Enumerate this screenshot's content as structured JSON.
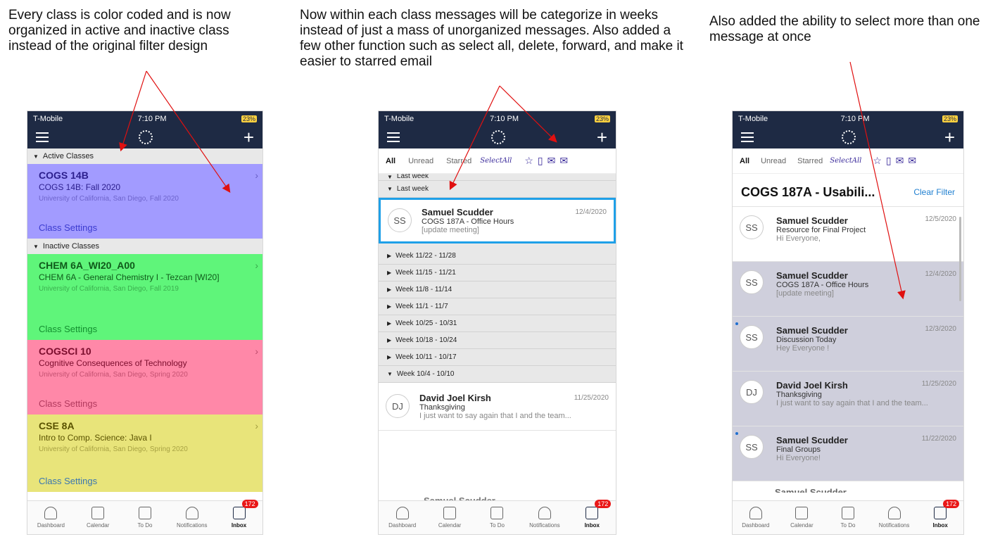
{
  "captions": {
    "left": "Every class is color coded and is now organized in active and inactive class instead of the original filter design",
    "middle": "Now within each class messages will be categorize in weeks instead of just a mass of unorganized messages. Also added a few other function such as select all, delete, forward, and make it easier to starred email",
    "right": "Also added the ability to select more than one message at once"
  },
  "status_bar": {
    "carrier": "T-Mobile",
    "time": "7:10 PM",
    "battery": "23%"
  },
  "tab_bar": {
    "items": [
      {
        "label": "Dashboard",
        "icon": "dashboard-icon"
      },
      {
        "label": "Calendar",
        "icon": "calendar-icon"
      },
      {
        "label": "To Do",
        "icon": "todo-icon"
      },
      {
        "label": "Notifications",
        "icon": "bell-icon"
      },
      {
        "label": "Inbox",
        "icon": "mail-icon"
      }
    ],
    "inbox_badge": "172"
  },
  "phone1": {
    "active_header": "Active Classes",
    "inactive_header": "Inactive Classes",
    "courses": [
      {
        "code": "COGS 14B",
        "title": "COGS 14B: Fall 2020",
        "school": "University of California, San Diego, Fall 2020",
        "settings": "Class Settings",
        "color": "#a29bff",
        "text_color": "#2b1e8c",
        "settings_color": "#3b3bd0"
      },
      {
        "code": "CHEM 6A_WI20_A00",
        "title": "CHEM 6A - General Chemistry I - Tezcan [WI20]",
        "school": "University of California, San Diego, Fall 2019",
        "settings": "Class Settings",
        "color": "#5ff57a",
        "text_color": "#0f5a1a",
        "settings_color": "#138f2f"
      },
      {
        "code": "COGSCI 10",
        "title": "Cognitive Consequences of Technology",
        "school": "University of California, San Diego, Spring 2020",
        "settings": "Class Settings",
        "color": "#ff88a8",
        "text_color": "#7a0c2c",
        "settings_color": "#b23a5e"
      },
      {
        "code": "CSE 8A",
        "title": "Intro to Comp. Science: Java I",
        "school": "University of California, San Diego, Spring 2020",
        "settings": "Class Settings",
        "color": "#e8e47a",
        "text_color": "#5a5200",
        "settings_color": "#3a76b0"
      }
    ]
  },
  "inbox": {
    "filters": [
      "All",
      "Unread",
      "Starred"
    ],
    "select_all": "SelectAll"
  },
  "phone2": {
    "clipped_week": "Last week",
    "last_week": "Last week",
    "selected_message": {
      "initials": "SS",
      "sender": "Samuel Scudder",
      "date": "12/4/2020",
      "subject": "COGS 187A - Office Hours",
      "preview": "[update meeting]"
    },
    "weeks": [
      "Week 11/22 - 11/28",
      "Week 11/15 - 11/21",
      "Week 11/8 - 11/14",
      "Week 11/1 - 11/7",
      "Week 10/25 - 10/31",
      "Week 10/18 - 10/24",
      "Week 10/11 - 10/17"
    ],
    "open_week": "Week 10/4 - 10/10",
    "open_message": {
      "initials": "DJ",
      "sender": "David Joel Kirsh",
      "date": "11/25/2020",
      "subject": "Thanksgiving",
      "preview": "I just want to say again that I and the team..."
    },
    "partial_sender": "Samuel Scudder"
  },
  "phone3": {
    "course_title": "COGS 187A - Usabili...",
    "clear_filter": "Clear Filter",
    "messages": [
      {
        "initials": "SS",
        "sender": "Samuel Scudder",
        "date": "12/5/2020",
        "subject": "Resource for Final Project",
        "preview": "Hi Everyone,",
        "selected": false,
        "unread": false
      },
      {
        "initials": "SS",
        "sender": "Samuel Scudder",
        "date": "12/4/2020",
        "subject": "COGS 187A - Office Hours",
        "preview": "[update meeting]",
        "selected": true,
        "unread": false
      },
      {
        "initials": "SS",
        "sender": "Samuel Scudder",
        "date": "12/3/2020",
        "subject": "Discussion Today",
        "preview": "Hey Everyone !",
        "selected": true,
        "unread": true
      },
      {
        "initials": "DJ",
        "sender": "David Joel Kirsh",
        "date": "11/25/2020",
        "subject": "Thanksgiving",
        "preview": "I just want to say again that I and the team...",
        "selected": true,
        "unread": false
      },
      {
        "initials": "SS",
        "sender": "Samuel Scudder",
        "date": "11/22/2020",
        "subject": "Final Groups",
        "preview": "Hi Everyone!",
        "selected": true,
        "unread": true
      }
    ],
    "partial_sender": "Samuel Scudder"
  },
  "colors": {
    "nav": "#1e2a44",
    "annotation_arrow": "#e01010",
    "selected_border": "#1fa0e8",
    "multi_select": "#cfcfdc"
  }
}
